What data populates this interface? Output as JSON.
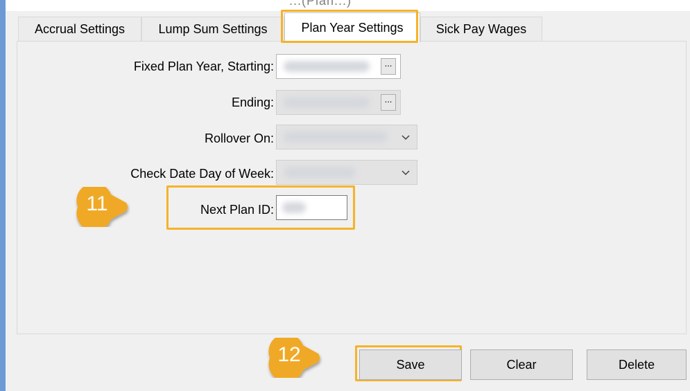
{
  "header": {
    "cutoff_text": "...(Plan...)"
  },
  "tabs": [
    {
      "label": "Accrual Settings"
    },
    {
      "label": "Lump Sum Settings"
    },
    {
      "label": "Plan Year Settings",
      "active": true
    },
    {
      "label": "Sick Pay Wages"
    }
  ],
  "form": {
    "fixed_plan_year_label": "Fixed Plan Year, Starting:",
    "ending_label": "Ending:",
    "rollover_label": "Rollover On:",
    "check_date_label": "Check Date Day of Week:",
    "next_plan_id_label": "Next Plan ID:",
    "ellipsis": "..."
  },
  "callouts": {
    "step11": "11",
    "step12": "12"
  },
  "buttons": {
    "save": "Save",
    "clear": "Clear",
    "delete": "Delete"
  },
  "colors": {
    "highlight": "#f5b32a",
    "callout": "#f0a928",
    "frame": "#6d9ad6"
  },
  "icons": {
    "ellipsis_button": "ellipsis-icon",
    "dropdown": "chevron-down-icon",
    "callout": "callout-arrow-icon"
  }
}
